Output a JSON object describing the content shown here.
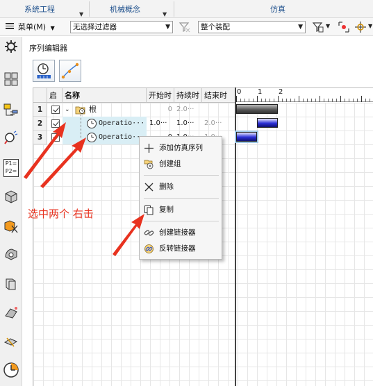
{
  "ribbon": {
    "groups": [
      {
        "label": "系统工程"
      },
      {
        "label": "机械概念"
      },
      {
        "label": "仿真"
      }
    ]
  },
  "toolbar": {
    "menu_label": "菜单(M)",
    "filter_value": "无选择过滤器",
    "assembly_value": "整个装配"
  },
  "left_bar": {
    "icons": [
      "gear-icon",
      "assembly-icon",
      "sequence-icon",
      "search-icon",
      "p1-p2-icon",
      "box-icon",
      "part-cut-icon",
      "part-icon",
      "book-icon",
      "corner-icon",
      "measure-icon",
      "clock-icon"
    ],
    "p_label_1": "P1=",
    "p_label_2": "P2="
  },
  "panel": {
    "title": "序列编辑器"
  },
  "table": {
    "headers": {
      "enabled": "启",
      "name": "名称",
      "start": "开始时",
      "duration": "持续时",
      "end": "结束时"
    },
    "rows": [
      {
        "num": "1",
        "name": "根",
        "start": "0",
        "duration": "2.0···",
        "end": ""
      },
      {
        "num": "2",
        "name": "Operatio···",
        "start": "1.0···",
        "duration": "1.0···",
        "end": "2.0···"
      },
      {
        "num": "3",
        "name": "Operatio···",
        "start": "0",
        "duration": "1.0···",
        "end": "1.0···"
      }
    ]
  },
  "gantt": {
    "ruler_labels": [
      "0",
      "1",
      "2"
    ],
    "bars": [
      {
        "row": 1,
        "start": 0,
        "end": 2,
        "style": "root"
      },
      {
        "row": 2,
        "start": 1,
        "end": 2,
        "style": "operation"
      },
      {
        "row": 3,
        "start": 0,
        "end": 1,
        "style": "operation"
      }
    ]
  },
  "context_menu": {
    "items": [
      {
        "label": "添加仿真序列",
        "icon": "plus-icon"
      },
      {
        "label": "创建组",
        "icon": "group-icon"
      },
      {
        "label": "删除",
        "icon": "delete-icon"
      },
      {
        "label": "复制",
        "icon": "copy-icon"
      },
      {
        "label": "创建链接器",
        "icon": "link-icon"
      },
      {
        "label": "反转链接器",
        "icon": "reverse-link-icon"
      }
    ]
  },
  "annotation": {
    "text": "选中两个 右击"
  },
  "colors": {
    "accent_blue": "#1d4f8c",
    "annotation_red": "#e8321f",
    "selection": "#d9eef5",
    "bar_blue": "#2b2fd6"
  }
}
